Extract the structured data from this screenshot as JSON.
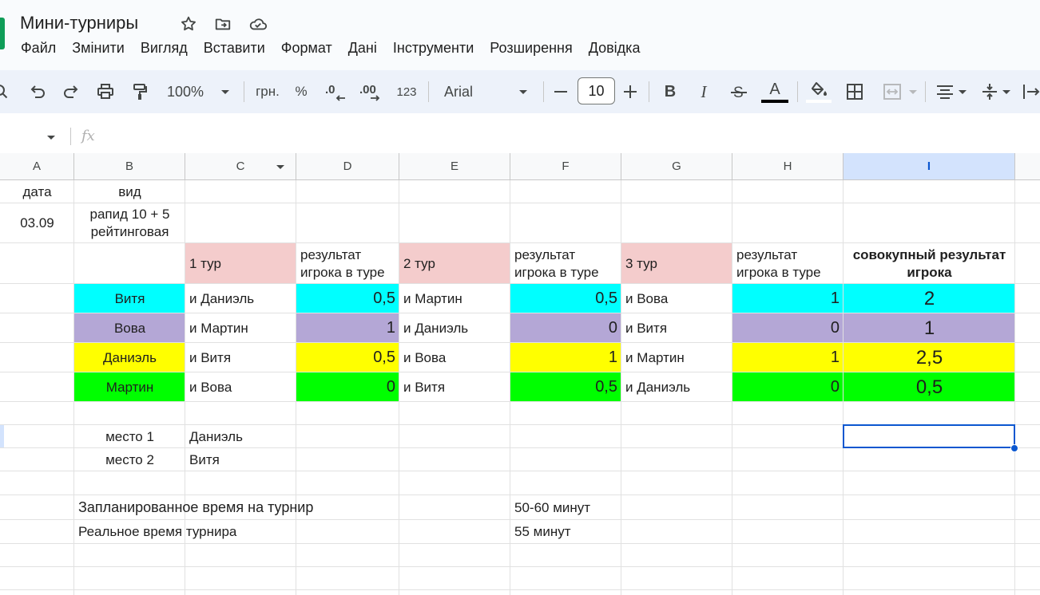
{
  "title": "Мини-турниры",
  "menu": [
    "Файл",
    "Змінити",
    "Вигляд",
    "Вставити",
    "Формат",
    "Дані",
    "Інструменти",
    "Розширення",
    "Довідка"
  ],
  "toolbar": {
    "zoom": "100%",
    "currency": "грн.",
    "percent": "%",
    "dec_decrease": ".0",
    "dec_increase": ".00",
    "number_format": "123",
    "font": "Arial",
    "font_size": "10",
    "minus": "—",
    "plus": "+",
    "bold": "B",
    "italic": "I",
    "text_color_letter": "A"
  },
  "formula": {
    "fx": "fx",
    "value": ""
  },
  "columns": [
    "A",
    "B",
    "C",
    "D",
    "E",
    "F",
    "G",
    "H",
    "I"
  ],
  "selected_column": "I",
  "sheet": {
    "r1": {
      "a": "дата",
      "b": "вид"
    },
    "r2": {
      "a": "03.09",
      "b": "рапид 10 + 5 рейтинговая"
    },
    "r3": {
      "c": "1 тур",
      "d": "результат игрока в туре",
      "e": "2 тур",
      "f": "результат игрока в туре",
      "g": "3 тур",
      "h": "результат игрока в туре",
      "i": "совокупный результат игрока"
    },
    "players": [
      {
        "name": "Витя",
        "r1_opp": "и Даниэль",
        "r1_res": "0,5",
        "r2_opp": "и Мартин",
        "r2_res": "0,5",
        "r3_opp": "и Вова",
        "r3_res": "1",
        "total": "2",
        "color": "#00ffff"
      },
      {
        "name": "Вова",
        "r1_opp": "и Мартин",
        "r1_res": "1",
        "r2_opp": "и Даниэль",
        "r2_res": "0",
        "r3_opp": "и Витя",
        "r3_res": "0",
        "total": "1",
        "color": "#b4a7d6"
      },
      {
        "name": "Даниэль",
        "r1_opp": "и Витя",
        "r1_res": "0,5",
        "r2_opp": "и Вова",
        "r2_res": "1",
        "r3_opp": "и Мартин",
        "r3_res": "1",
        "total": "2,5",
        "color": "#ffff00"
      },
      {
        "name": "Мартин",
        "r1_opp": "и Вова",
        "r1_res": "0",
        "r2_opp": "и Витя",
        "r2_res": "0,5",
        "r3_opp": "и Даниэль",
        "r3_res": "0",
        "total": "0,5",
        "color": "#00ff00"
      }
    ],
    "places": [
      {
        "label": "место 1",
        "name": "Даниэль"
      },
      {
        "label": "место 2",
        "name": "Витя"
      }
    ],
    "planned_label": "Запланированное время на турнир",
    "planned_value": "50-60 минут",
    "real_label": "Реальное время турнира",
    "real_value": "55 минут"
  },
  "colors": {
    "round_header": "#f4cccc",
    "accent": "#0b57d0"
  }
}
